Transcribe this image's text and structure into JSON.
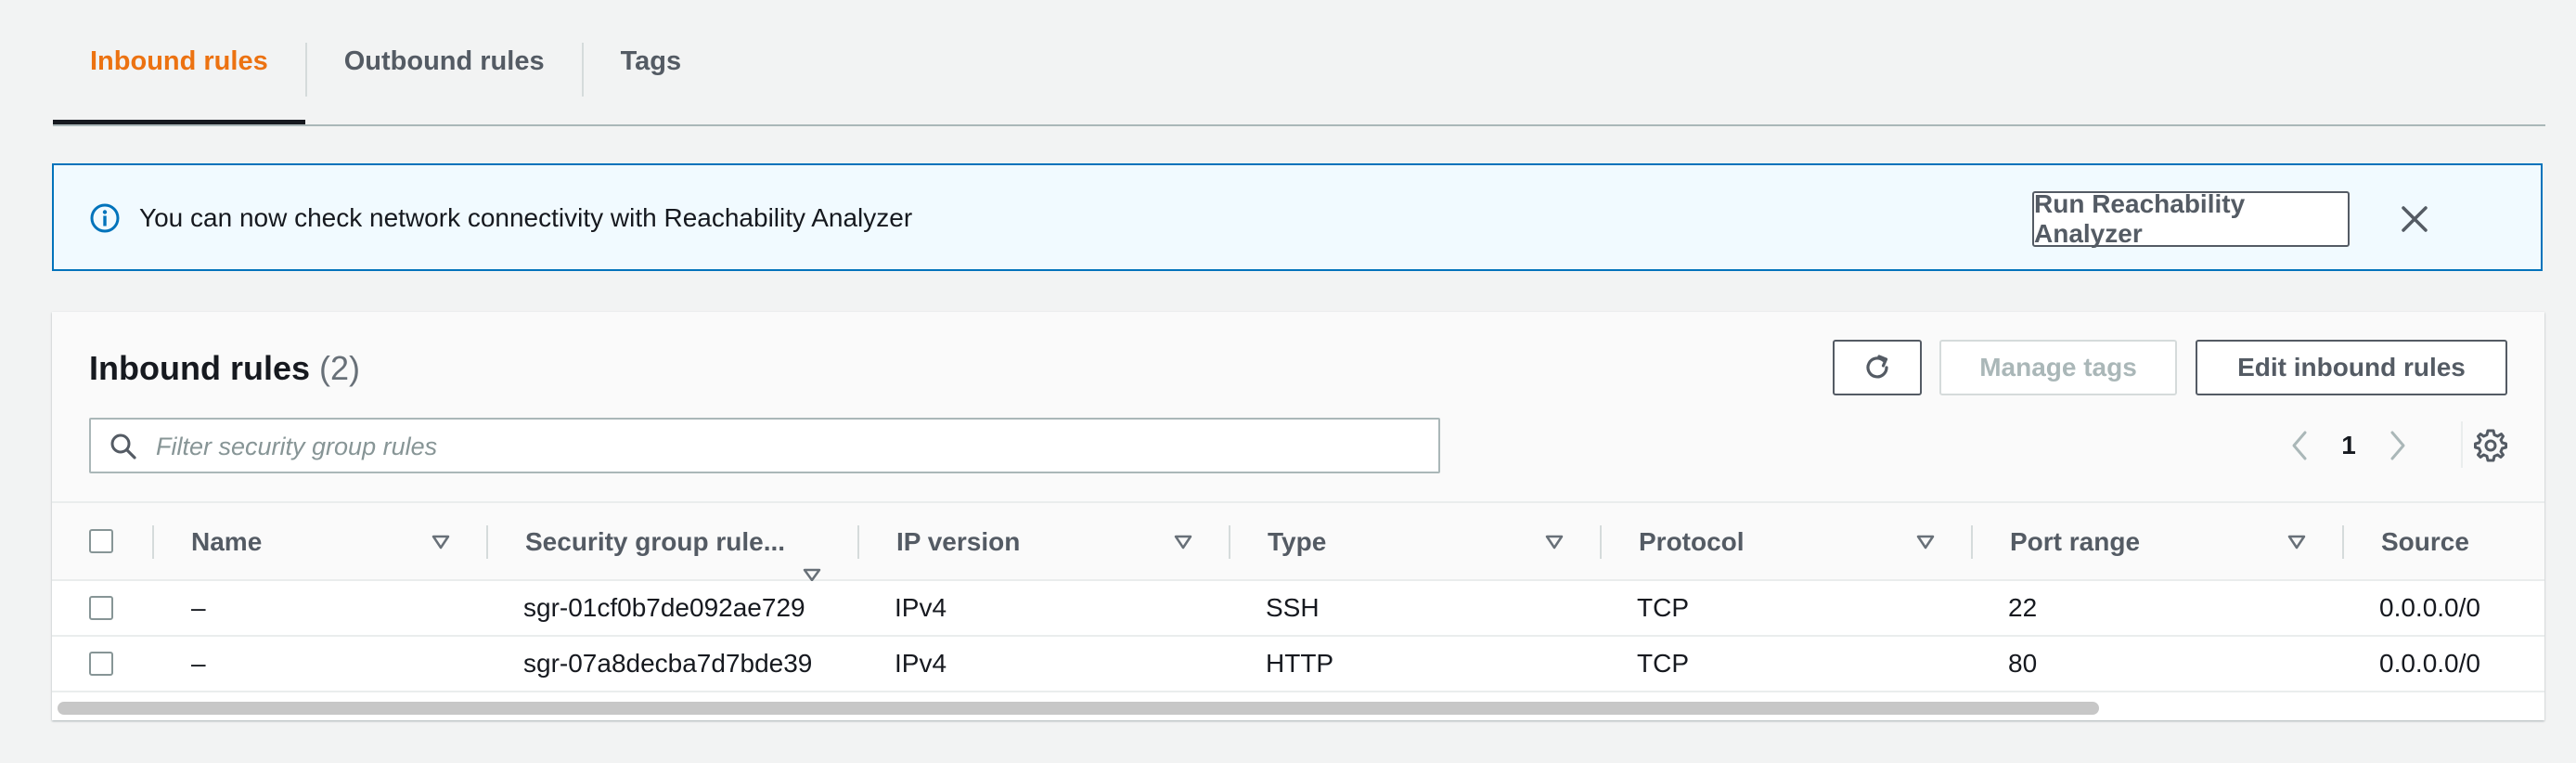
{
  "tabs": [
    {
      "label": "Inbound rules",
      "active": true
    },
    {
      "label": "Outbound rules",
      "active": false
    },
    {
      "label": "Tags",
      "active": false
    }
  ],
  "banner": {
    "icon": "info-icon",
    "message": "You can now check network connectivity with Reachability Analyzer",
    "action_label": "Run Reachability Analyzer",
    "close_icon": "close-icon",
    "color": "#0073bb"
  },
  "panel": {
    "title": "Inbound rules",
    "count": "(2)",
    "refresh_icon": "refresh-icon",
    "manage_tags_label": "Manage tags",
    "edit_label": "Edit inbound rules",
    "search_placeholder": "Filter security group rules",
    "page": "1",
    "settings_icon": "gear-icon"
  },
  "table": {
    "columns": [
      "Name",
      "Security group rule...",
      "IP version",
      "Type",
      "Protocol",
      "Port range",
      "Source"
    ],
    "rows": [
      {
        "name": "–",
        "rule_id": "sgr-01cf0b7de092ae729",
        "ip_version": "IPv4",
        "type": "SSH",
        "protocol": "TCP",
        "port_range": "22",
        "source": "0.0.0.0/0"
      },
      {
        "name": "–",
        "rule_id": "sgr-07a8decba7d7bde39",
        "ip_version": "IPv4",
        "type": "HTTP",
        "protocol": "TCP",
        "port_range": "80",
        "source": "0.0.0.0/0"
      }
    ]
  },
  "colors": {
    "accent": "#ec7211",
    "border": "#aab7b8",
    "text": "#16191f",
    "muted": "#545b64"
  }
}
